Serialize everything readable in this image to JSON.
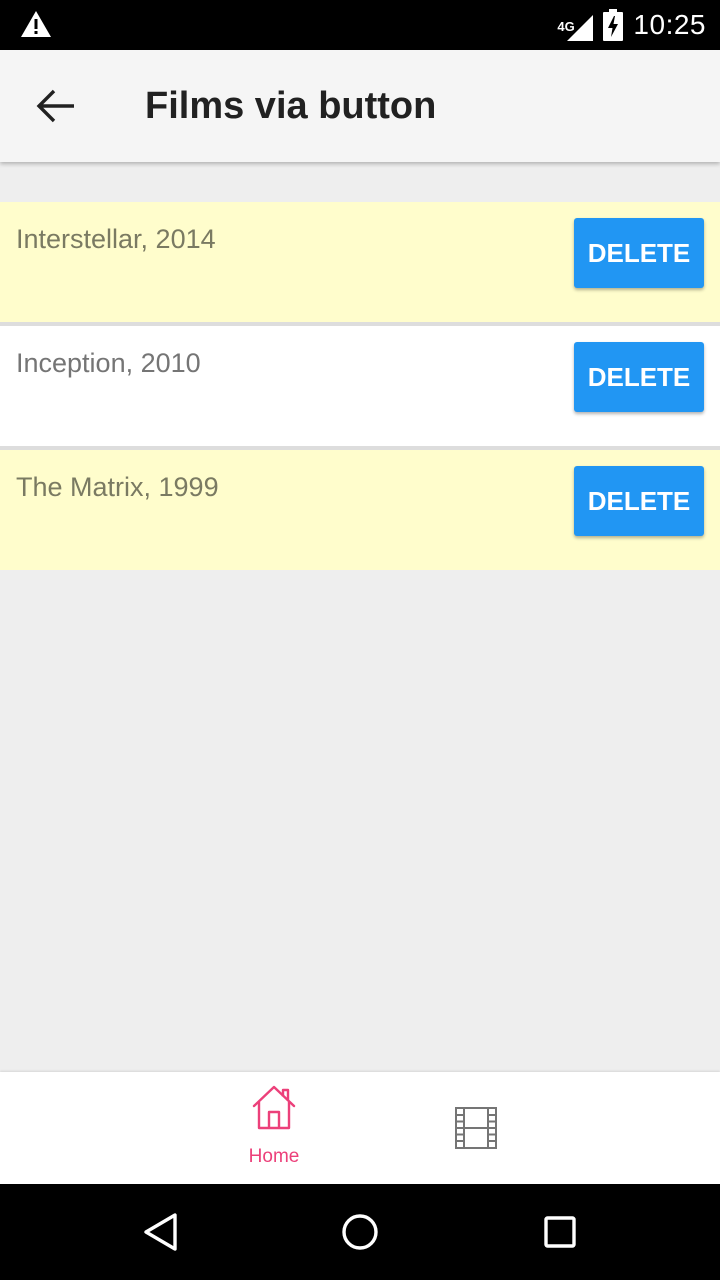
{
  "status_bar": {
    "network_type": "4G",
    "time": "10:25",
    "icons": [
      "warning-icon",
      "signal-icon",
      "battery-charging-icon"
    ]
  },
  "app_bar": {
    "title": "Films via button",
    "back_icon": "arrow-back-icon"
  },
  "films": [
    {
      "label": "Interstellar, 2014",
      "button_label": "DELETE",
      "background": "#fffdcc"
    },
    {
      "label": "Inception, 2010",
      "button_label": "DELETE",
      "background": "#ffffff"
    },
    {
      "label": "The Matrix, 1999",
      "button_label": "DELETE",
      "background": "#fffdcc"
    }
  ],
  "bottom_nav": {
    "items": [
      {
        "label": "Home",
        "icon": "home-icon",
        "active": true
      },
      {
        "label": "",
        "icon": "film-icon",
        "active": false
      }
    ]
  },
  "system_nav": {
    "icons": [
      "back-triangle-icon",
      "home-circle-icon",
      "recents-square-icon"
    ]
  },
  "colors": {
    "accent_button": "#2196f3",
    "nav_active": "#ec407a",
    "nav_inactive": "#757575",
    "highlight_row": "#fffdcc",
    "film_text": "#7a7a62",
    "film_text_plain": "#757575"
  }
}
